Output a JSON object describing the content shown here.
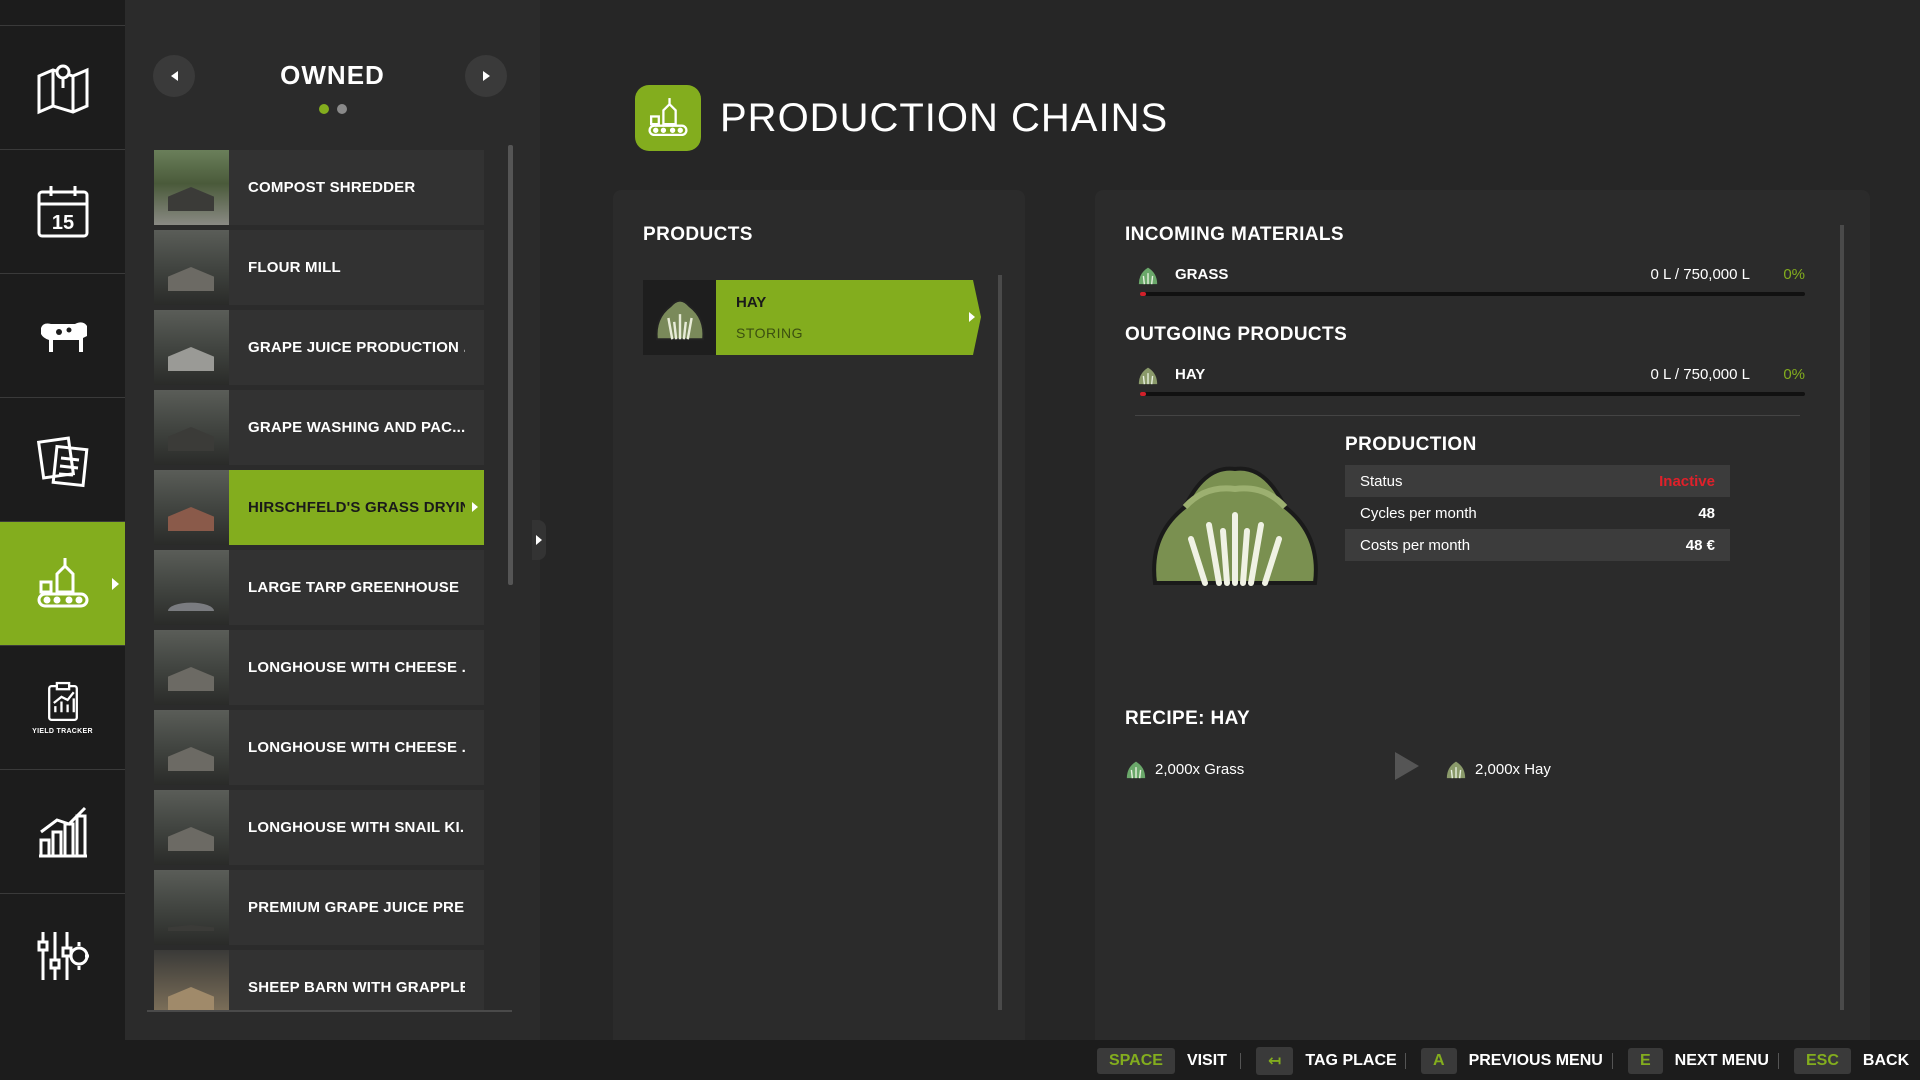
{
  "nav": {
    "items": [
      {
        "name": "map",
        "icon": "map-icon"
      },
      {
        "name": "calendar",
        "icon": "calendar-icon",
        "day": "15"
      },
      {
        "name": "animals",
        "icon": "cow-icon"
      },
      {
        "name": "contracts",
        "icon": "documents-icon"
      },
      {
        "name": "production",
        "icon": "production-icon",
        "active": true
      },
      {
        "name": "yield-tracker",
        "icon": "yield-tracker-icon",
        "label": "YIELD TRACKER"
      },
      {
        "name": "statistics",
        "icon": "chart-icon"
      },
      {
        "name": "settings",
        "icon": "settings-icon"
      }
    ]
  },
  "list": {
    "title": "OWNED",
    "items": [
      {
        "label": "COMPOST SHREDDER"
      },
      {
        "label": "FLOUR MILL"
      },
      {
        "label": "GRAPE JUICE PRODUCTION ..."
      },
      {
        "label": "GRAPE WASHING AND PAC..."
      },
      {
        "label": "HIRSCHFELD'S GRASS DRYING",
        "active": true
      },
      {
        "label": "LARGE TARP GREENHOUSE"
      },
      {
        "label": "LONGHOUSE WITH CHEESE ..."
      },
      {
        "label": "LONGHOUSE WITH CHEESE ..."
      },
      {
        "label": "LONGHOUSE WITH SNAIL KI..."
      },
      {
        "label": "PREMIUM GRAPE JUICE PRE..."
      },
      {
        "label": "SHEEP BARN WITH GRAPPLE"
      }
    ]
  },
  "header": {
    "title": "PRODUCTION CHAINS",
    "icon": "production-icon"
  },
  "products": {
    "heading": "PRODUCTS",
    "items": [
      {
        "name": "HAY",
        "mode": "STORING",
        "icon": "hay-icon"
      }
    ]
  },
  "details": {
    "incoming_heading": "INCOMING MATERIALS",
    "incoming": [
      {
        "name": "GRASS",
        "qty": "0 L / 750,000 L",
        "pct": "0%",
        "fill": 0
      }
    ],
    "outgoing_heading": "OUTGOING PRODUCTS",
    "outgoing": [
      {
        "name": "HAY",
        "qty": "0 L / 750,000 L",
        "pct": "0%",
        "fill": 0
      }
    ],
    "production_heading": "PRODUCTION",
    "production": [
      {
        "label": "Status",
        "value": "Inactive"
      },
      {
        "label": "Cycles per month",
        "value": "48"
      },
      {
        "label": "Costs per month",
        "value": "48 €"
      }
    ],
    "recipe_heading": "RECIPE: HAY",
    "recipe_input": "2,000x Grass",
    "recipe_output": "2,000x Hay"
  },
  "bottom": {
    "hints": [
      {
        "key": "SPACE",
        "label": "VISIT"
      },
      {
        "key": "↤",
        "label": "TAG PLACE"
      },
      {
        "key": "A",
        "label": "PREVIOUS MENU"
      },
      {
        "key": "E",
        "label": "NEXT MENU"
      },
      {
        "key": "ESC",
        "label": "BACK"
      }
    ]
  },
  "colors": {
    "accent": "#83ad1e",
    "bad": "#e0202a"
  }
}
